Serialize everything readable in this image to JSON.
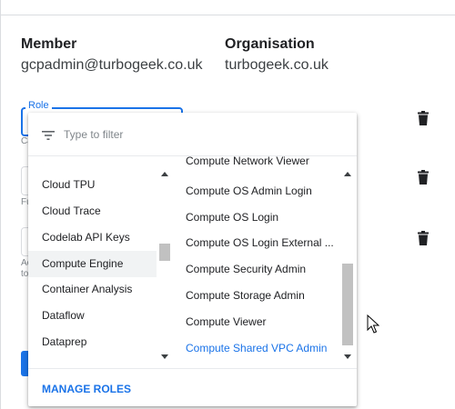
{
  "dialog_title": "",
  "member": {
    "label": "Member",
    "value": "gcpadmin@turbogeek.co.uk"
  },
  "organisation": {
    "label": "Organisation",
    "value": "turbogeek.co.uk"
  },
  "role_field": {
    "label": "Role"
  },
  "hints": {
    "row1": "Ca",
    "row2": "Fu",
    "row3a": "Ac",
    "row3b": "to"
  },
  "dropdown": {
    "filter_placeholder": "Type to filter",
    "left_items": [
      "Cloud TPU",
      "Cloud Trace",
      "Codelab API Keys",
      "Compute Engine",
      "Container Analysis",
      "Dataflow",
      "Dataprep"
    ],
    "left_active": "Compute Engine",
    "right_items": [
      "Compute Network Viewer",
      "Compute OS Admin Login",
      "Compute OS Login",
      "Compute OS Login External ...",
      "Compute Security Admin",
      "Compute Storage Admin",
      "Compute Viewer",
      "Compute Shared VPC Admin"
    ],
    "right_selected": "Compute Shared VPC Admin",
    "manage_roles": "MANAGE ROLES"
  },
  "icons": [
    "filter-icon",
    "trash-icon",
    "scroll-up-arrow",
    "scroll-down-arrow",
    "mouse-pointer"
  ],
  "colors": {
    "accent": "#1a73e8",
    "text": "#202124",
    "border": "#dadce0",
    "active_bg": "#f1f3f4"
  }
}
